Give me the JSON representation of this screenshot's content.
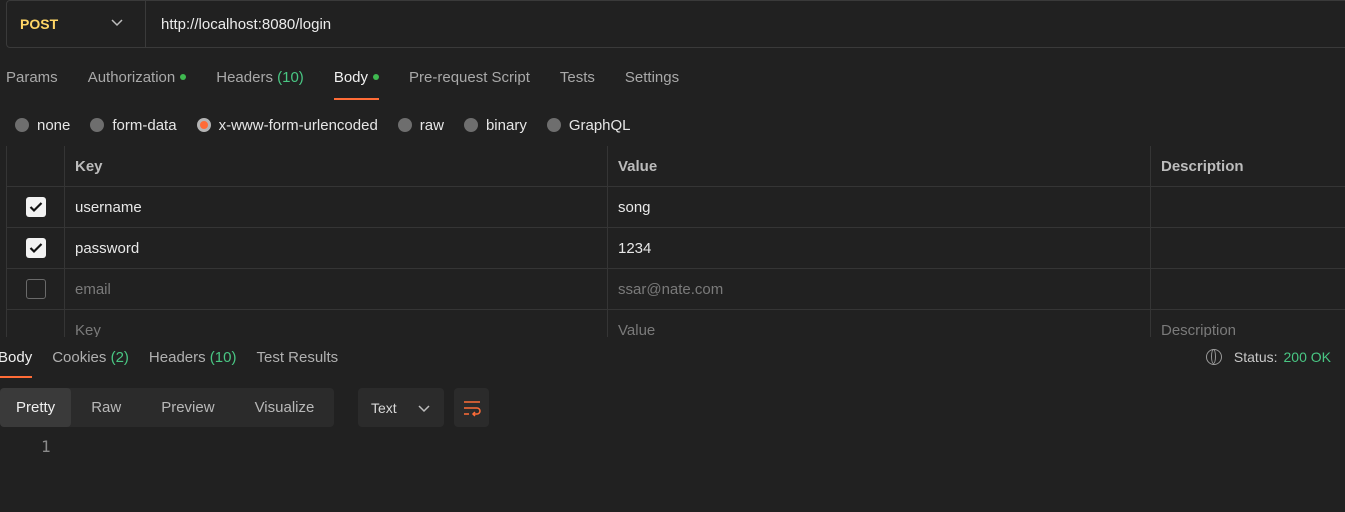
{
  "request": {
    "method": "POST",
    "url": "http://localhost:8080/login"
  },
  "request_tabs": [
    {
      "label": "Params",
      "count": "",
      "dot": false,
      "active": false
    },
    {
      "label": "Authorization",
      "count": "",
      "dot": true,
      "active": false
    },
    {
      "label": "Headers",
      "count": "(10)",
      "dot": false,
      "active": false
    },
    {
      "label": "Body",
      "count": "",
      "dot": true,
      "active": true
    },
    {
      "label": "Pre-request Script",
      "count": "",
      "dot": false,
      "active": false
    },
    {
      "label": "Tests",
      "count": "",
      "dot": false,
      "active": false
    },
    {
      "label": "Settings",
      "count": "",
      "dot": false,
      "active": false
    }
  ],
  "body_types": [
    {
      "label": "none",
      "selected": false
    },
    {
      "label": "form-data",
      "selected": false
    },
    {
      "label": "x-www-form-urlencoded",
      "selected": true
    },
    {
      "label": "raw",
      "selected": false
    },
    {
      "label": "binary",
      "selected": false
    },
    {
      "label": "GraphQL",
      "selected": false
    }
  ],
  "table": {
    "headers": {
      "key": "Key",
      "value": "Value",
      "description": "Description"
    },
    "rows": [
      {
        "checked": true,
        "key": "username",
        "value": "song",
        "description": ""
      },
      {
        "checked": true,
        "key": "password",
        "value": "1234",
        "description": ""
      },
      {
        "checked": false,
        "key": "email",
        "value": "ssar@nate.com",
        "description": ""
      }
    ],
    "placeholder": {
      "key": "Key",
      "value": "Value",
      "description": "Description"
    }
  },
  "response_tabs": [
    {
      "label": "Body",
      "count": "",
      "active": true
    },
    {
      "label": "Cookies",
      "count": "(2)",
      "active": false
    },
    {
      "label": "Headers",
      "count": "(10)",
      "active": false
    },
    {
      "label": "Test Results",
      "count": "",
      "active": false
    }
  ],
  "status": {
    "label": "Status:",
    "value": "200 OK"
  },
  "format_modes": [
    {
      "label": "Pretty",
      "active": true
    },
    {
      "label": "Raw",
      "active": false
    },
    {
      "label": "Preview",
      "active": false
    },
    {
      "label": "Visualize",
      "active": false
    }
  ],
  "language": "Text",
  "line_number": "1",
  "icons": {
    "method_dropdown": "chevron-down-icon",
    "language_dropdown": "chevron-down-icon",
    "wrap": "wrap-lines-icon",
    "globe": "globe-icon",
    "check": "checkmark-icon"
  },
  "colors": {
    "accent": "#ff6c37",
    "method": "#ffd666",
    "success": "#49c683",
    "dot": "#3fb950"
  }
}
